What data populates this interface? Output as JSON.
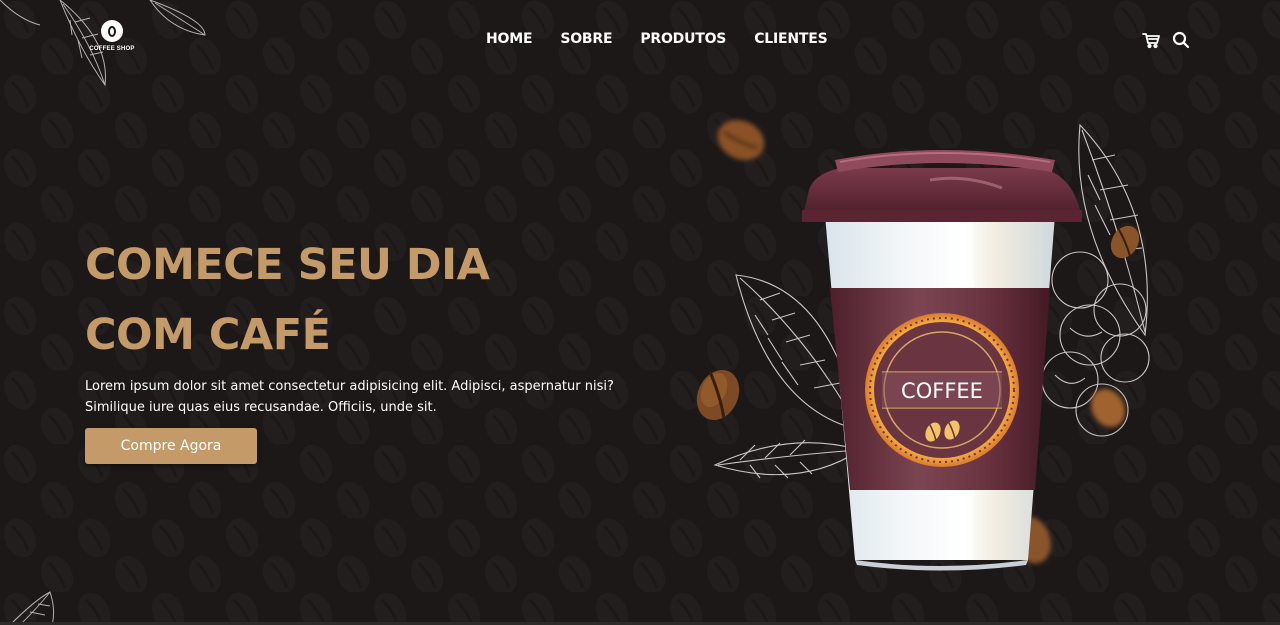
{
  "brand": {
    "logo_text": "COFFEE SHOP"
  },
  "nav": {
    "items": [
      {
        "label": "HOME"
      },
      {
        "label": "SOBRE"
      },
      {
        "label": "PRODUTOS"
      },
      {
        "label": "CLIENTES"
      }
    ]
  },
  "header_icons": [
    "cart-icon",
    "search-icon"
  ],
  "hero": {
    "title_line1": "COMECE SEU DIA",
    "title_line2": "COM CAFÉ",
    "text": "Lorem ipsum dolor sit amet consectetur adipisicing elit. Adipisci, aspernatur nisi? Similique iure quas eius recusandae. Officiis, unde sit.",
    "cta_label": "Compre Agora"
  },
  "cup": {
    "label": "COFFEE"
  },
  "colors": {
    "background": "#1c1818",
    "accent": "#c49a68",
    "cup_sleeve": "#6b3441",
    "text": "#ffffff"
  }
}
